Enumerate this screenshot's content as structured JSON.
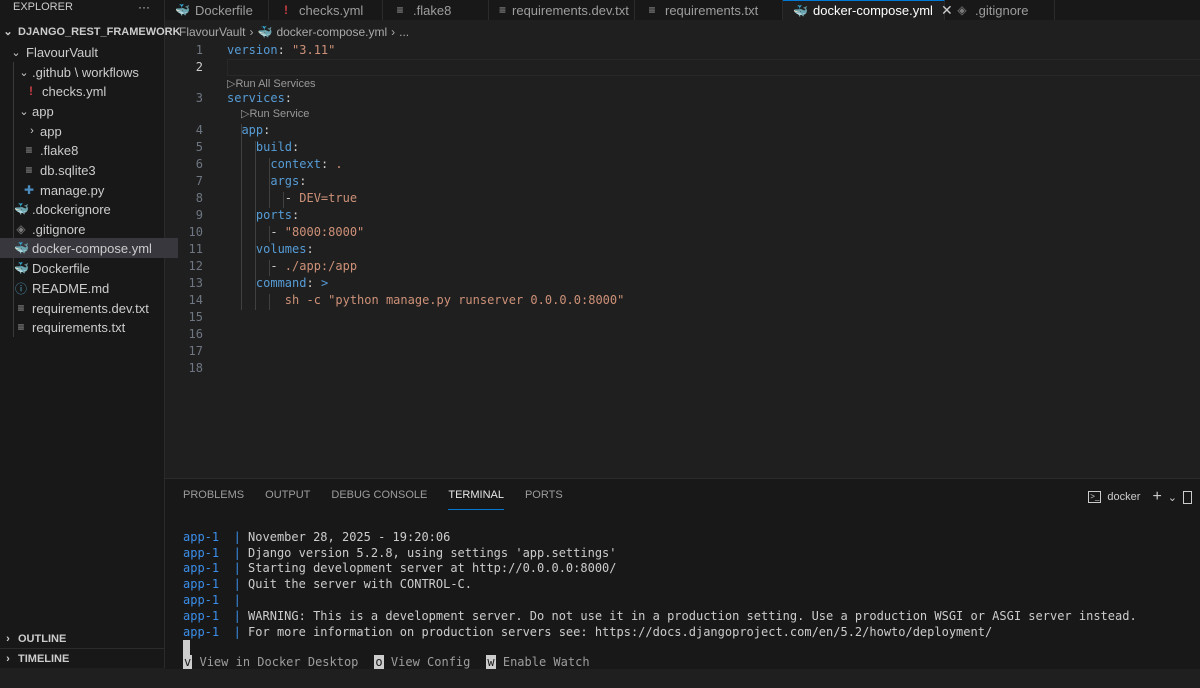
{
  "explorer": {
    "title": "EXPLORER",
    "more": "···",
    "root": "DJANGO_REST_FRAMEWORK",
    "items": [
      {
        "label": "FlavourVault",
        "icon": "chevron-down"
      },
      {
        "label": ".github \\ workflows",
        "icon": "chevron-down"
      },
      {
        "label": "checks.yml",
        "icon": "yml-file"
      },
      {
        "label": "app",
        "icon": "chevron-down"
      },
      {
        "label": "app",
        "icon": "chevron-right"
      },
      {
        "label": ".flake8",
        "icon": "lines-file"
      },
      {
        "label": "db.sqlite3",
        "icon": "lines-file"
      },
      {
        "label": "manage.py",
        "icon": "python-file"
      },
      {
        "label": ".dockerignore",
        "icon": "docker-file"
      },
      {
        "label": ".gitignore",
        "icon": "git-file"
      },
      {
        "label": "docker-compose.yml",
        "icon": "docker-compose-file"
      },
      {
        "label": "Dockerfile",
        "icon": "docker-file"
      },
      {
        "label": "README.md",
        "icon": "info-file"
      },
      {
        "label": "requirements.dev.txt",
        "icon": "lines-file"
      },
      {
        "label": "requirements.txt",
        "icon": "lines-file"
      }
    ],
    "outline": "OUTLINE",
    "timeline": "TIMELINE"
  },
  "tabs": [
    {
      "label": "Dockerfile",
      "icon": "docker-icon"
    },
    {
      "label": "checks.yml",
      "icon": "yml-icon"
    },
    {
      "label": ".flake8",
      "icon": "lines-icon"
    },
    {
      "label": "requirements.dev.txt",
      "icon": "lines-icon"
    },
    {
      "label": "requirements.txt",
      "icon": "lines-icon"
    },
    {
      "label": "docker-compose.yml",
      "icon": "docker-compose-icon"
    },
    {
      "label": ".gitignore",
      "icon": "git-icon"
    }
  ],
  "breadcrumb": {
    "folder": "FlavourVault",
    "file": "docker-compose.yml",
    "more": "..."
  },
  "editor": {
    "line_numbers": [
      "1",
      "2",
      "3",
      "4",
      "5",
      "6",
      "7",
      "8",
      "9",
      "10",
      "11",
      "12",
      "13",
      "14",
      "15",
      "16",
      "17",
      "18"
    ],
    "codelens_run_all": "Run All Services",
    "codelens_run": "Run Service",
    "lines": {
      "l1_key": "version",
      "l1_val": "\"3.11\"",
      "l3_key": "services",
      "l4_key": "app",
      "l5_key": "build",
      "l6_key": "context",
      "l6_val": ".",
      "l7_key": "args",
      "l8_val": "DEV=true",
      "l9_key": "ports",
      "l10_val": "\"8000:8000\"",
      "l11_key": "volumes",
      "l12_val": "./app:/app",
      "l13_key": "command",
      "l13_val": ">",
      "l14_val": "sh -c \"python manage.py runserver 0.0.0.0:8000\""
    }
  },
  "panel": {
    "tabs": [
      "PROBLEMS",
      "OUTPUT",
      "DEBUG CONSOLE",
      "TERMINAL",
      "PORTS"
    ],
    "active_tab": "TERMINAL",
    "terminal_name": "docker",
    "add_icon": "+",
    "terminal": {
      "prefix": "app-1",
      "lines": [
        "November 28, 2025 - 19:20:06",
        "Django version 5.2.8, using settings 'app.settings'",
        "Starting development server at http://0.0.0.0:8000/",
        "Quit the server with CONTROL-C.",
        "",
        "WARNING: This is a development server. Do not use it in a production setting. Use a production WSGI or ASGI server instead.",
        "For more information on production servers see: https://docs.djangoproject.com/en/5.2/howto/deployment/"
      ]
    },
    "footer": [
      {
        "key": "v",
        "label": "View in Docker Desktop"
      },
      {
        "key": "o",
        "label": "View Config"
      },
      {
        "key": "w",
        "label": "Enable Watch"
      }
    ]
  }
}
